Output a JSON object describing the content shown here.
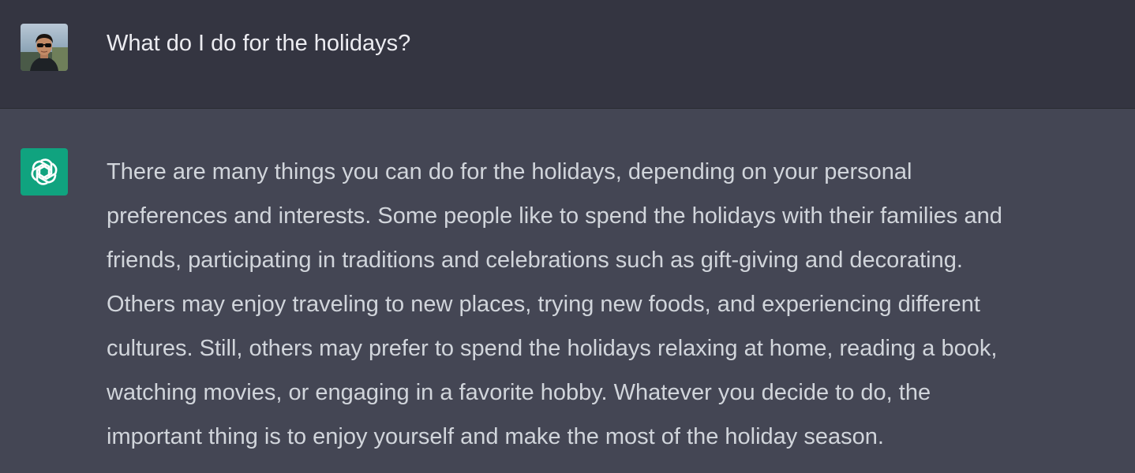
{
  "user_message": {
    "avatar_icon": "user-photo-avatar",
    "text": "What do I do for the holidays?"
  },
  "assistant_message": {
    "avatar_icon": "openai-logo-icon",
    "avatar_color": "#10a37f",
    "lines": [
      "There are many things you can do for the holidays, depending on your personal",
      "preferences and interests. Some people like to spend the holidays with their families and",
      "friends, participating in traditions and celebrations such as gift-giving and decorating.",
      "Others may enjoy traveling to new places, trying new foods, and experiencing different",
      "cultures. Still, others may prefer to spend the holidays relaxing at home, reading a book,",
      "watching movies, or engaging in a favorite hobby. Whatever you decide to do, the",
      "important thing is to enjoy yourself and make the most of the holiday season."
    ]
  },
  "colors": {
    "user_bg": "#343541",
    "assistant_bg": "#444654",
    "user_text": "#ececf1",
    "assistant_text": "#d1d5db"
  }
}
